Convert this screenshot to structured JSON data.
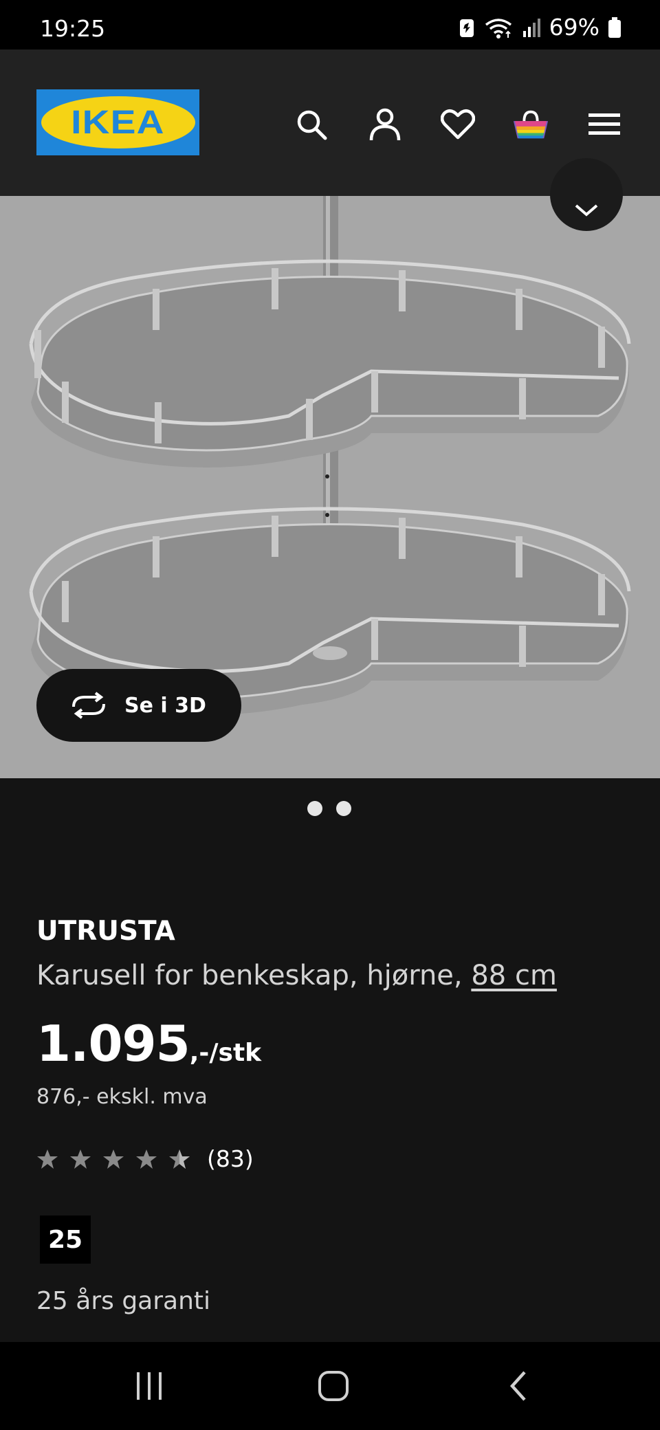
{
  "status_bar": {
    "time": "19:25",
    "battery": "69%"
  },
  "header": {
    "logo_text": "IKEA",
    "icons": [
      "search-icon",
      "account-icon",
      "heart-icon",
      "basket-icon",
      "menu-icon"
    ]
  },
  "hero": {
    "button_3d_label": "Se i 3D",
    "images_count": 2,
    "active_image": 1
  },
  "product": {
    "name": "UTRUSTA",
    "description": "Karusell for benkeskap, hjørne, ",
    "size": "88 cm",
    "price": "1.095",
    "price_suffix": ",-/stk",
    "price_ex_vat": "876,- ekskl. mva",
    "rating_stars": 4.5,
    "rating_count": "(83)",
    "warranty_badge": "25",
    "warranty_text": "25 års garanti"
  },
  "colors": {
    "background": "#141414",
    "header": "#222222",
    "hero": "#a7a7a7",
    "ikea_blue": "#1f86d9",
    "ikea_yellow": "#f5d315"
  }
}
